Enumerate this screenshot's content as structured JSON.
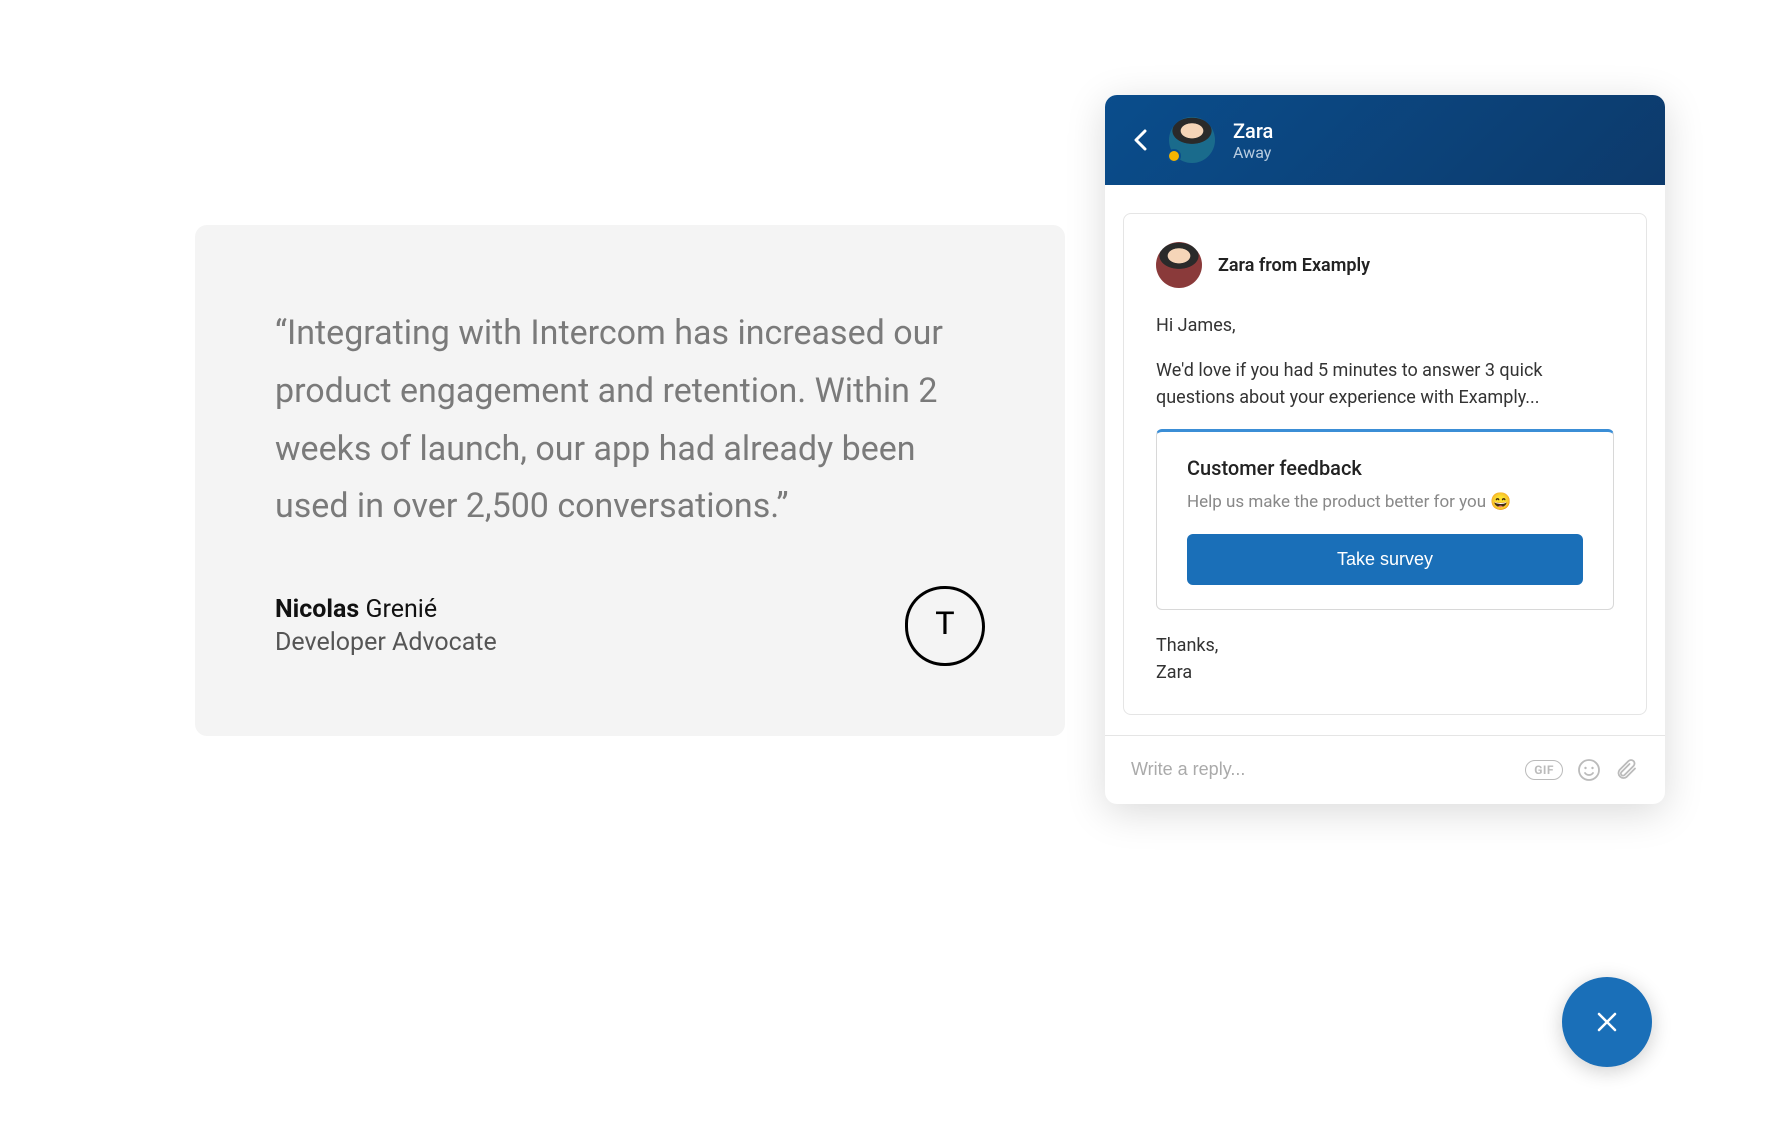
{
  "quote": {
    "text": "“Integrating with Intercom has increased our product engagement and retention. Within 2 weeks of launch, our app had already been used in over 2,500 conversations.”",
    "author_first": "Nicolas",
    "author_last": "Grenié",
    "author_title": "Developer Advocate",
    "logo_letter": "T"
  },
  "chat": {
    "header": {
      "name": "Zara",
      "status": "Away"
    },
    "message": {
      "from": "Zara from Examply",
      "greeting": "Hi James,",
      "body": "We'd love if you had 5 minutes to answer 3 quick questions about your experience with Examply...",
      "signoff": "Thanks,\nZara"
    },
    "feedback": {
      "title": "Customer feedback",
      "subtitle": "Help us make the product better for you 😄",
      "button": "Take survey"
    },
    "composer": {
      "placeholder": "Write a reply..."
    },
    "gif_label": "GIF"
  }
}
